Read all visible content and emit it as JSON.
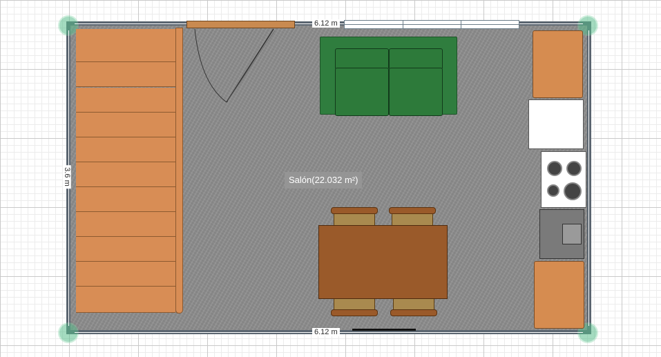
{
  "room": {
    "label": "Salón(22.032 m²)"
  },
  "dimensions": {
    "top_width": "6.12 m",
    "bottom_width": "6.12 m",
    "left_height": "3.6 m"
  },
  "colors": {
    "floor": "#8e8e8e",
    "wall": "#5a6570",
    "stairs": "#d88d55",
    "sofa": "#2f7d3e",
    "table": "#9a5a2a",
    "cabinet": "#d68c50",
    "corner_handle": "#5abe8c"
  },
  "icons": [
    "stairs-icon",
    "door-icon",
    "window-icon",
    "sofa-icon",
    "dining-table-icon",
    "chair-icon",
    "kitchen-cabinet-icon",
    "fridge-icon",
    "stove-icon",
    "sink-icon"
  ]
}
